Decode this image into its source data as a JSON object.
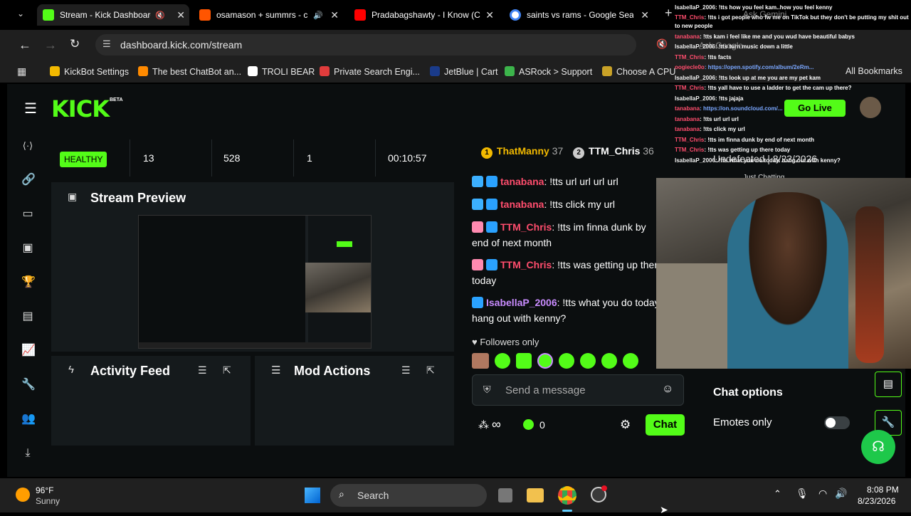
{
  "browser": {
    "tabs": [
      {
        "title": "Stream - Kick Dashboard",
        "favicon_color": "#53fc18",
        "active": true
      },
      {
        "title": "osamason + summrs - c",
        "favicon_color": "#ff5500",
        "active": false
      },
      {
        "title": "Pradabagshawty - I Know (C",
        "favicon_color": "#ff0000",
        "active": false
      },
      {
        "title": "saints vs rams - Google Sear",
        "favicon_color": "#4285f4",
        "active": false
      }
    ],
    "url": "dashboard.kick.com/stream",
    "bookmarks": [
      {
        "label": "KickBot Settings",
        "color": "#f2b900"
      },
      {
        "label": "The best ChatBot an...",
        "color": "#ff8a00"
      },
      {
        "label": "TROLI BEAR",
        "color": "#ffffff"
      },
      {
        "label": "Private Search Engi...",
        "color": "#e03c3c"
      },
      {
        "label": "JetBlue | Cart",
        "color": "#1a3b8a"
      },
      {
        "label": "ASRock > Support",
        "color": "#3cb44b"
      },
      {
        "label": "Choose A CPU",
        "color": "#c9a227"
      }
    ],
    "all_bookmarks": "All Bookmarks"
  },
  "kick": {
    "logo": "KICK",
    "beta": "BETA",
    "go_live": "Go Live",
    "stats": {
      "health": "HEALTHY",
      "viewers": "13",
      "followers": "528",
      "subs": "1",
      "uptime": "00:10:57"
    },
    "stream_preview": "Stream Preview",
    "activity_feed": "Activity Feed",
    "mod_actions": "Mod Actions",
    "leaderboard": [
      {
        "rank": "1",
        "name": "ThatManny",
        "count": "37"
      },
      {
        "rank": "2",
        "name": "TTM_Chris",
        "count": "36"
      }
    ],
    "chat": [
      {
        "user": "tanabana",
        "user_color": "#ff4d6d",
        "text": ": !tts url url url url"
      },
      {
        "user": "tanabana",
        "user_color": "#ff4d6d",
        "text": ": !tts click my url"
      },
      {
        "user": "TTM_Chris",
        "user_color": "#ff4d6d",
        "text": ": !tts im finna dunk by end of next month"
      },
      {
        "user": "TTM_Chris",
        "user_color": "#ff4d6d",
        "text": ": !tts was getting up there today"
      },
      {
        "user": "IsabellaP_2006",
        "user_color": "#c98cff",
        "text": ": !tts what you do today. hang out with kenny?"
      }
    ],
    "followers_only": "Followers only",
    "message_placeholder": "Send a message",
    "infinity": "∞",
    "points": "0",
    "chat_button": "Chat",
    "chat_options": "Chat options",
    "emotes_only": "Emotes only"
  },
  "overlay": {
    "chat_lines": [
      {
        "user": "IsabellaP_2006",
        "color": "#f0f0f0",
        "text": ": !tts how you feel kam..how you feel kenny"
      },
      {
        "user": "TTM_Chris",
        "color": "#ff4d6d",
        "text": ": !tts i got people who fw me on TikTok but they don't be putting my shit out to new people"
      },
      {
        "user": "tanabana",
        "color": "#ff4d6d",
        "text": ": !tts kam i feel like me and you wud have beautiful babys"
      },
      {
        "user": "IsabellaP_2006",
        "color": "#f0f0f0",
        "text": ": !tts turn music down a little"
      },
      {
        "user": "TTM_Chris",
        "color": "#ff4d6d",
        "text": ": !tts facts"
      },
      {
        "user": "oogiecle0o",
        "color": "#ff4d6d",
        "text": ": https://open.spotify.com/album/2eRm..."
      },
      {
        "user": "IsabellaP_2006",
        "color": "#f0f0f0",
        "text": ": !tts look up at me you are my pet kam"
      },
      {
        "user": "TTM_Chris",
        "color": "#ff4d6d",
        "text": ": !tts yall have to use a ladder to get the cam up there?"
      },
      {
        "user": "IsabellaP_2006",
        "color": "#f0f0f0",
        "text": ": !tts jajaja"
      },
      {
        "user": "tanabana",
        "color": "#ff4d6d",
        "text": ": https://on.soundcloud.com/..."
      },
      {
        "user": "tanabana",
        "color": "#ff4d6d",
        "text": ": !tts url url url"
      },
      {
        "user": "tanabana",
        "color": "#ff4d6d",
        "text": ": !tts click my url"
      },
      {
        "user": "TTM_Chris",
        "color": "#ff4d6d",
        "text": ": !tts im finna dunk by end of next month"
      },
      {
        "user": "TTM_Chris",
        "color": "#ff4d6d",
        "text": ": !tts was getting up there today"
      },
      {
        "user": "IsabellaP_2006",
        "color": "#f0f0f0",
        "text": ": !tts what you do today. hang out with kenny?"
      }
    ],
    "ask_google": "Ask Google",
    "ask_gemini": "Ask Gemini",
    "undefeated": "Undefeated | 8/23/2026",
    "just_chatting": "Just Chatting"
  },
  "taskbar": {
    "weather_temp": "96°F",
    "weather_desc": "Sunny",
    "search": "Search",
    "time": "8:08 PM",
    "date": "8/23/2026"
  },
  "colors": {
    "kick_green": "#53fc18",
    "bg": "#0b0e0f",
    "panel": "#151a1c"
  }
}
